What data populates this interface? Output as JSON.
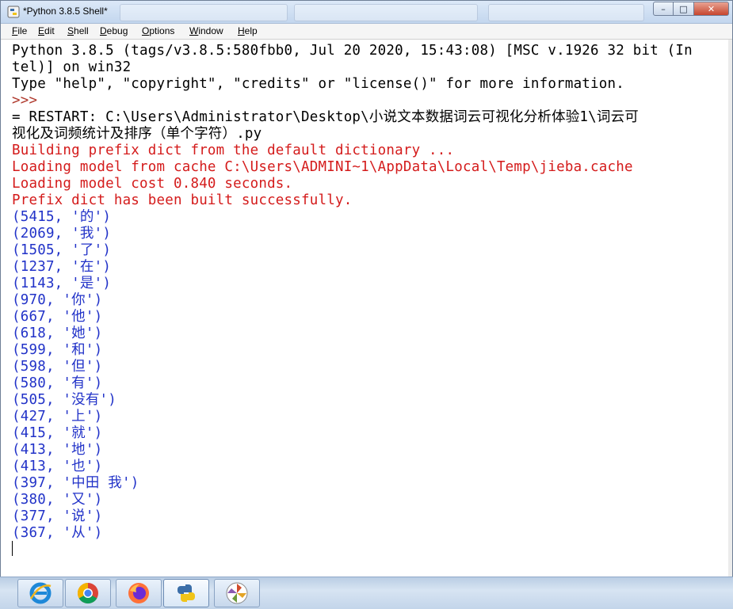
{
  "window": {
    "title": "*Python 3.8.5 Shell*",
    "controls": {
      "minimize": "–",
      "maximize": "□",
      "close": "✕"
    }
  },
  "menu": [
    {
      "label": "File"
    },
    {
      "label": "Edit"
    },
    {
      "label": "Shell"
    },
    {
      "label": "Debug"
    },
    {
      "label": "Options"
    },
    {
      "label": "Window"
    },
    {
      "label": "Help"
    }
  ],
  "shell": {
    "banner": [
      "Python 3.8.5 (tags/v3.8.5:580fbb0, Jul 20 2020, 15:43:08) [MSC v.1926 32 bit (In",
      "tel)] on win32",
      "Type \"help\", \"copyright\", \"credits\" or \"license()\" for more information."
    ],
    "prompt": ">>>",
    "restart": [
      "= RESTART: C:\\Users\\Administrator\\Desktop\\小说文本数据词云可视化分析体验1\\词云可",
      "视化及词频统计及排序（单个字符）.py"
    ],
    "stderr": [
      "Building prefix dict from the default dictionary ...",
      "Loading model from cache C:\\Users\\ADMINI~1\\AppData\\Local\\Temp\\jieba.cache",
      "Loading model cost 0.840 seconds.",
      "Prefix dict has been built successfully."
    ],
    "results": [
      "(5415, '的')",
      "(2069, '我')",
      "(1505, '了')",
      "(1237, '在')",
      "(1143, '是')",
      "(970, '你')",
      "(667, '他')",
      "(618, '她')",
      "(599, '和')",
      "(598, '但')",
      "(580, '有')",
      "(505, '没有')",
      "(427, '上')",
      "(415, '就')",
      "(413, '地')",
      "(413, '也')",
      "(397, '中田 我')",
      "(380, '又')",
      "(377, '说')",
      "(367, '从')"
    ]
  },
  "taskbar": {
    "items": [
      {
        "icon": "ie-icon"
      },
      {
        "icon": "chrome-icon"
      },
      {
        "icon": "firefox-icon"
      },
      {
        "icon": "python-icon"
      },
      {
        "icon": "pinwheel-app-icon"
      }
    ]
  },
  "colors": {
    "stderr": "#d41b1b",
    "stdout": "#2132c8",
    "prompt": "#b03a2e"
  }
}
